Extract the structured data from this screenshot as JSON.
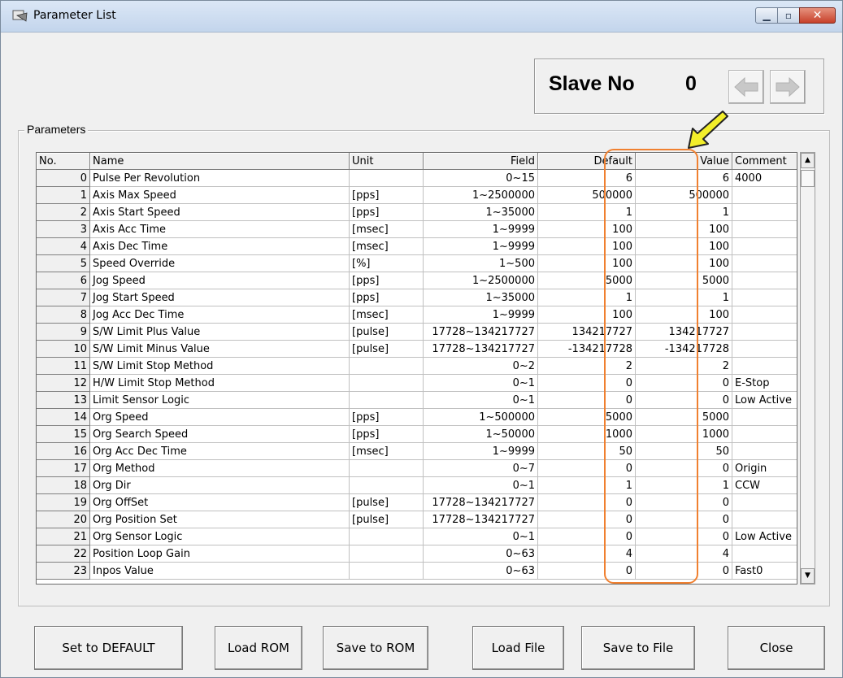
{
  "window": {
    "title": "Parameter List"
  },
  "slave": {
    "label": "Slave No",
    "value": "0"
  },
  "group": {
    "label": "Parameters"
  },
  "columns": {
    "no": "No.",
    "name": "Name",
    "unit": "Unit",
    "field": "Field",
    "default": "Default",
    "value": "Value",
    "comment": "Comment"
  },
  "rows": [
    {
      "no": "0",
      "name": "Pulse Per Revolution",
      "unit": "",
      "field": "0~15",
      "default": "6",
      "value": "6",
      "comment": "4000"
    },
    {
      "no": "1",
      "name": "Axis Max Speed",
      "unit": "[pps]",
      "field": "1~2500000",
      "default": "500000",
      "value": "500000",
      "comment": ""
    },
    {
      "no": "2",
      "name": "Axis Start Speed",
      "unit": "[pps]",
      "field": "1~35000",
      "default": "1",
      "value": "1",
      "comment": ""
    },
    {
      "no": "3",
      "name": "Axis Acc Time",
      "unit": "[msec]",
      "field": "1~9999",
      "default": "100",
      "value": "100",
      "comment": ""
    },
    {
      "no": "4",
      "name": "Axis Dec Time",
      "unit": "[msec]",
      "field": "1~9999",
      "default": "100",
      "value": "100",
      "comment": ""
    },
    {
      "no": "5",
      "name": "Speed Override",
      "unit": "[%]",
      "field": "1~500",
      "default": "100",
      "value": "100",
      "comment": ""
    },
    {
      "no": "6",
      "name": "Jog Speed",
      "unit": "[pps]",
      "field": "1~2500000",
      "default": "5000",
      "value": "5000",
      "comment": ""
    },
    {
      "no": "7",
      "name": "Jog Start Speed",
      "unit": "[pps]",
      "field": "1~35000",
      "default": "1",
      "value": "1",
      "comment": ""
    },
    {
      "no": "8",
      "name": "Jog Acc Dec Time",
      "unit": "[msec]",
      "field": "1~9999",
      "default": "100",
      "value": "100",
      "comment": ""
    },
    {
      "no": "9",
      "name": "S/W Limit Plus Value",
      "unit": "[pulse]",
      "field": "17728~134217727",
      "default": "134217727",
      "value": "134217727",
      "comment": ""
    },
    {
      "no": "10",
      "name": "S/W Limit Minus Value",
      "unit": "[pulse]",
      "field": "17728~134217727",
      "default": "-134217728",
      "value": "-134217728",
      "comment": ""
    },
    {
      "no": "11",
      "name": "S/W Limit Stop Method",
      "unit": "",
      "field": "0~2",
      "default": "2",
      "value": "2",
      "comment": ""
    },
    {
      "no": "12",
      "name": "H/W Limit Stop Method",
      "unit": "",
      "field": "0~1",
      "default": "0",
      "value": "0",
      "comment": "E-Stop"
    },
    {
      "no": "13",
      "name": "Limit Sensor Logic",
      "unit": "",
      "field": "0~1",
      "default": "0",
      "value": "0",
      "comment": "Low Active"
    },
    {
      "no": "14",
      "name": "Org Speed",
      "unit": "[pps]",
      "field": "1~500000",
      "default": "5000",
      "value": "5000",
      "comment": ""
    },
    {
      "no": "15",
      "name": "Org Search Speed",
      "unit": "[pps]",
      "field": "1~50000",
      "default": "1000",
      "value": "1000",
      "comment": ""
    },
    {
      "no": "16",
      "name": "Org Acc Dec Time",
      "unit": "[msec]",
      "field": "1~9999",
      "default": "50",
      "value": "50",
      "comment": ""
    },
    {
      "no": "17",
      "name": "Org Method",
      "unit": "",
      "field": "0~7",
      "default": "0",
      "value": "0",
      "comment": "Origin"
    },
    {
      "no": "18",
      "name": "Org Dir",
      "unit": "",
      "field": "0~1",
      "default": "1",
      "value": "1",
      "comment": "CCW"
    },
    {
      "no": "19",
      "name": "Org OffSet",
      "unit": "[pulse]",
      "field": "17728~134217727",
      "default": "0",
      "value": "0",
      "comment": ""
    },
    {
      "no": "20",
      "name": "Org Position Set",
      "unit": "[pulse]",
      "field": "17728~134217727",
      "default": "0",
      "value": "0",
      "comment": ""
    },
    {
      "no": "21",
      "name": "Org Sensor Logic",
      "unit": "",
      "field": "0~1",
      "default": "0",
      "value": "0",
      "comment": "Low Active"
    },
    {
      "no": "22",
      "name": "Position Loop Gain",
      "unit": "",
      "field": "0~63",
      "default": "4",
      "value": "4",
      "comment": ""
    },
    {
      "no": "23",
      "name": "Inpos Value",
      "unit": "",
      "field": "0~63",
      "default": "0",
      "value": "0",
      "comment": "Fast0"
    }
  ],
  "buttons": {
    "set_default": "Set to DEFAULT",
    "load_rom": "Load ROM",
    "save_rom": "Save to ROM",
    "load_file": "Load File",
    "save_file": "Save to File",
    "close": "Close"
  },
  "icons": {
    "app": "parameter-list-icon",
    "minimize": "minimize-icon",
    "maximize": "maximize-icon",
    "close": "close-icon",
    "prev": "left-arrow-icon",
    "next": "right-arrow-icon",
    "scroll_up": "scroll-up-icon",
    "scroll_down": "scroll-down-icon",
    "callout": "yellow-callout-arrow-icon"
  },
  "colors": {
    "highlight": "#f08030",
    "callout_arrow": "#f2ee2a",
    "close_button": "#c7402a"
  }
}
